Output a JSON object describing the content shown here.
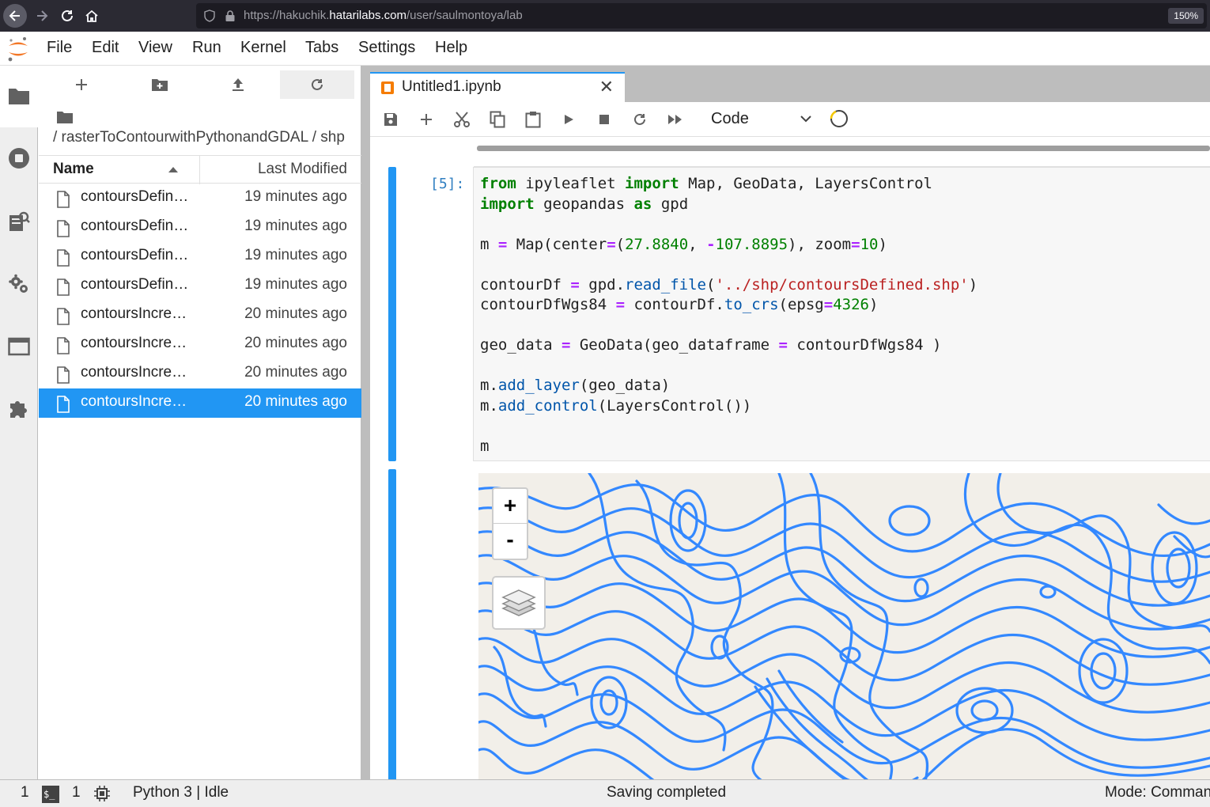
{
  "browser": {
    "url_prefix": "https://hakuchik.",
    "url_domain": "hatarilabs.com",
    "url_path": "/user/saulmontoya/lab",
    "zoom": "150%"
  },
  "menu": {
    "items": [
      "File",
      "Edit",
      "View",
      "Run",
      "Kernel",
      "Tabs",
      "Settings",
      "Help"
    ]
  },
  "file_browser": {
    "breadcrumb": "/ rasterToContourwithPythonandGDAL / shp",
    "header_name": "Name",
    "header_modified": "Last Modified",
    "files": [
      {
        "name": "contoursDefin…",
        "modified": "19 minutes ago"
      },
      {
        "name": "contoursDefin…",
        "modified": "19 minutes ago"
      },
      {
        "name": "contoursDefin…",
        "modified": "19 minutes ago"
      },
      {
        "name": "contoursDefin…",
        "modified": "19 minutes ago"
      },
      {
        "name": "contoursIncre…",
        "modified": "20 minutes ago"
      },
      {
        "name": "contoursIncre…",
        "modified": "20 minutes ago"
      },
      {
        "name": "contoursIncre…",
        "modified": "20 minutes ago"
      },
      {
        "name": "contoursIncre…",
        "modified": "20 minutes ago"
      }
    ],
    "selected_index": 7
  },
  "notebook": {
    "tab_title": "Untitled1.ipynb",
    "cell_type": "Code",
    "prompt": "[5]:",
    "code_lines": [
      "from ipyleaflet import Map, GeoData, LayersControl",
      "import geopandas as gpd",
      "",
      "m = Map(center=(27.8840, -107.8895), zoom=10)",
      "",
      "contourDf = gpd.read_file('../shp/contoursDefined.shp')",
      "contourDfWgs84 = contourDf.to_crs(epsg=4326)",
      "",
      "geo_data = GeoData(geo_dataframe = contourDfWgs84 )",
      "",
      "m.add_layer(geo_data)",
      "m.add_control(LayersControl())",
      "",
      "m"
    ],
    "map": {
      "zoom_in": "+",
      "zoom_out": "-",
      "contour_color": "#3388ff",
      "base_color": "#f2efe9"
    }
  },
  "status": {
    "left_count_1": "1",
    "left_count_2": "1",
    "kernel": "Python 3 | Idle",
    "message": "Saving completed",
    "mode": "Mode: Command"
  },
  "colors": {
    "accent": "#2196f3",
    "jupyter_orange": "#f37726"
  }
}
